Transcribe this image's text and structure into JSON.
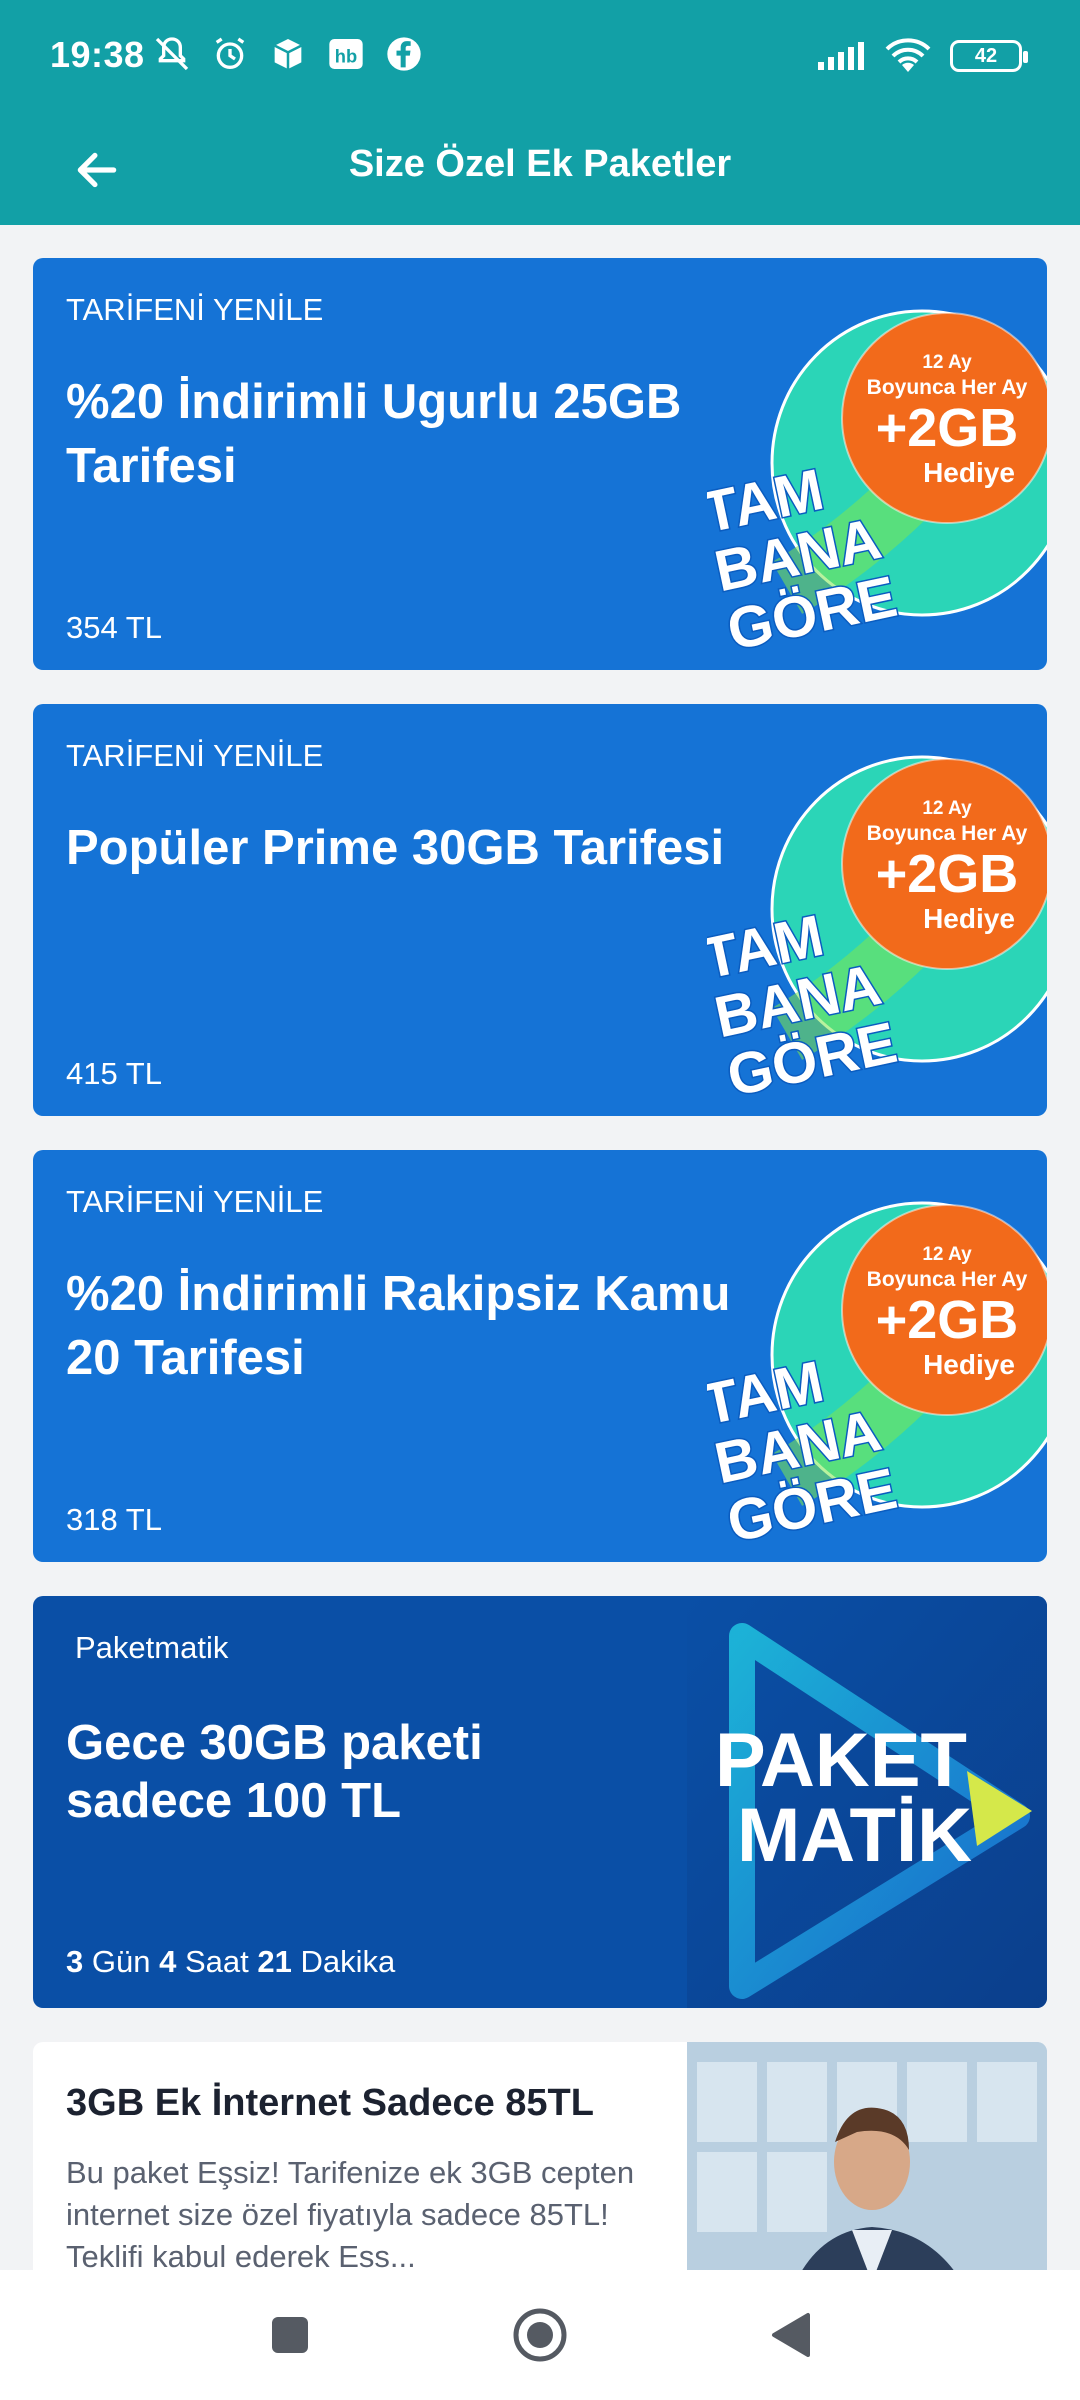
{
  "status_bar": {
    "time": "19:38",
    "battery": "42",
    "icons": [
      "mute-icon",
      "alarm-icon",
      "package-icon",
      "hb-icon",
      "facebook-icon",
      "signal-icon",
      "wifi-icon",
      "battery-icon"
    ]
  },
  "header": {
    "title": "Size Özel Ek Paketler",
    "back_icon": "arrow-left-icon"
  },
  "promo_badge": {
    "line1": "12 Ay",
    "line2": "Boyunca Her Ay",
    "amount": "+2GB",
    "line3": "Hediye",
    "slogan1": "TAM",
    "slogan2": "BANA",
    "slogan3": "GÖRE"
  },
  "cards": [
    {
      "eyebrow": "TARİFENİ YENİLE",
      "title": "%20 İndirimli Ugurlu 25GB Tarifesi",
      "price": "354 TL"
    },
    {
      "eyebrow": "TARİFENİ YENİLE",
      "title": "Popüler Prime 30GB Tarifesi",
      "price": "415 TL"
    },
    {
      "eyebrow": "TARİFENİ YENİLE",
      "title": "%20 İndirimli Rakipsiz Kamu 20 Tarifesi",
      "price": "318 TL"
    }
  ],
  "paketmatik": {
    "eyebrow": "Paketmatik",
    "title": "Gece 30GB paketi sadece 100 TL",
    "logo1": "PAKET",
    "logo2": "MATİK",
    "timer": {
      "days": "3",
      "days_label": "Gün",
      "hours": "4",
      "hours_label": "Saat",
      "minutes": "21",
      "minutes_label": "Dakika"
    }
  },
  "extra_card": {
    "title": "3GB Ek İnternet Sadece 85TL",
    "description": "Bu paket Eşsiz! Tarifenize ek 3GB cepten internet size özel fiyatıyla sadece 85TL! Teklifi kabul ederek Ess..."
  },
  "navbar": {
    "icons": [
      "recents-icon",
      "home-icon",
      "back-icon"
    ]
  },
  "colors": {
    "header": "#12a0a6",
    "card_blue": "#1573d6",
    "card_dark": "#0a4fa6",
    "orange": "#f26a1b",
    "green": "#2fd98a"
  }
}
